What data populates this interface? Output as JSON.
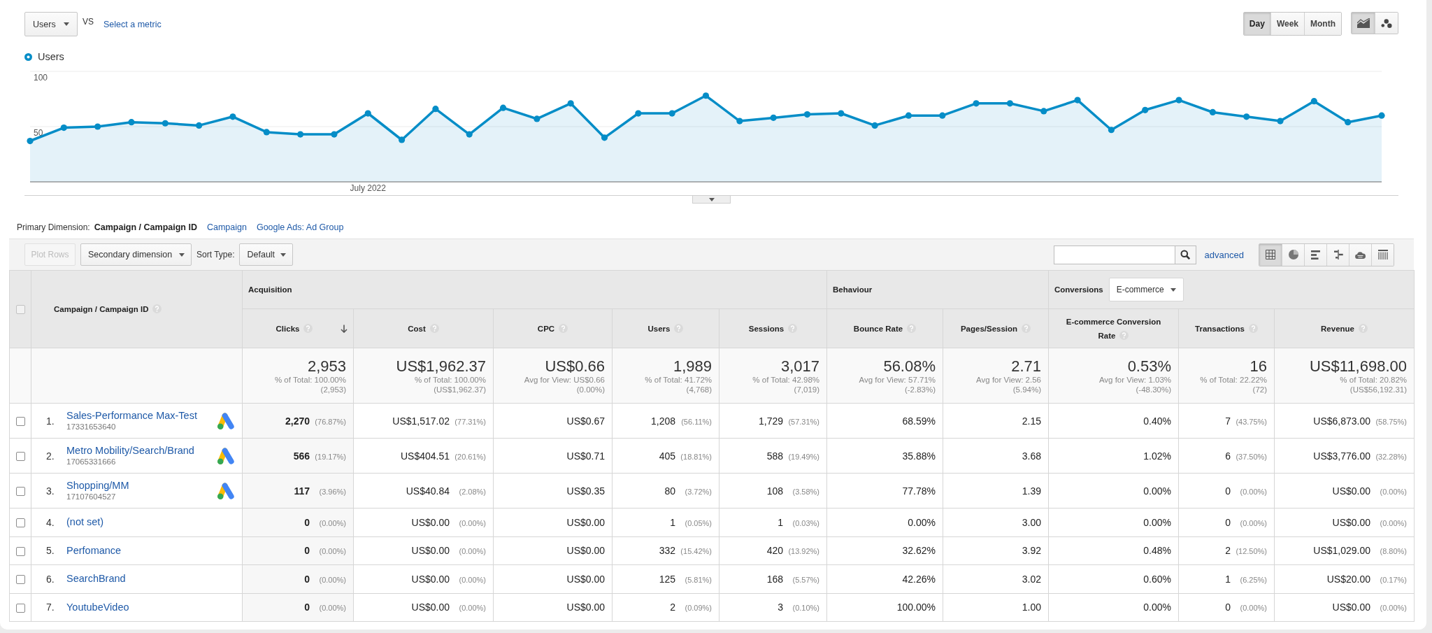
{
  "metric_selector": {
    "metric": "Users",
    "vs_label": "VS",
    "compare_link": "Select a metric"
  },
  "period_buttons": [
    {
      "label": "Day",
      "selected": true
    },
    {
      "label": "Week",
      "selected": false
    },
    {
      "label": "Month",
      "selected": false
    }
  ],
  "chart_type_buttons": [
    {
      "kind": "line",
      "selected": true
    },
    {
      "kind": "motion",
      "selected": false
    }
  ],
  "chart": {
    "chart_data": {
      "type": "area",
      "xlabel": "July 2022",
      "ylim": [
        0,
        100
      ],
      "yticks": [
        100,
        50
      ],
      "series": [
        {
          "name": "Users",
          "color": "#058dc7",
          "values": [
            37,
            49,
            50,
            54,
            53,
            51,
            59,
            45,
            43,
            43,
            62,
            38,
            66,
            43,
            67,
            57,
            71,
            40,
            62,
            62,
            78,
            55,
            58,
            61,
            62,
            51,
            60,
            60,
            71,
            71,
            64,
            74,
            47,
            65,
            74,
            63,
            59,
            55,
            73,
            54,
            60
          ]
        }
      ]
    }
  },
  "primary_dimension": {
    "label": "Primary Dimension:",
    "options": [
      {
        "label": "Campaign / Campaign ID",
        "selected": true
      },
      {
        "label": "Campaign",
        "selected": false
      },
      {
        "label": "Google Ads: Ad Group",
        "selected": false
      }
    ]
  },
  "toolbar": {
    "plot_rows": {
      "label": "Plot Rows",
      "disabled": true
    },
    "secondary_dimension": "Secondary dimension",
    "sort_type_label": "Sort Type:",
    "sort_type": "Default",
    "advanced_link": "advanced",
    "views": [
      {
        "kind": "table",
        "selected": true
      },
      {
        "kind": "pie",
        "selected": false
      },
      {
        "kind": "bar",
        "selected": false
      },
      {
        "kind": "comparison",
        "selected": false
      },
      {
        "kind": "cloud",
        "selected": false
      },
      {
        "kind": "pivot",
        "selected": false
      }
    ]
  },
  "table": {
    "select_all": {
      "checked": false
    },
    "dimension_column": {
      "label": "Campaign / Campaign ID",
      "sorted": false
    },
    "column_groups": [
      {
        "label": "Acquisition",
        "columns": [
          {
            "label": "Clicks",
            "sorted": true
          },
          {
            "label": "Cost",
            "sorted": false
          },
          {
            "label": "CPC",
            "sorted": false
          },
          {
            "label": "Users",
            "sorted": false
          },
          {
            "label": "Sessions",
            "sorted": false
          }
        ]
      },
      {
        "label": "Behaviour",
        "columns": [
          {
            "label": "Bounce Rate",
            "sorted": false
          },
          {
            "label": "Pages/Session",
            "sorted": false
          }
        ]
      },
      {
        "label": "Conversions",
        "dropdown": "E-commerce",
        "columns": [
          {
            "label": "E-commerce Conversion Rate",
            "sorted": false
          },
          {
            "label": "Transactions",
            "sorted": false
          },
          {
            "label": "Revenue",
            "sorted": false
          }
        ]
      }
    ],
    "totals": [
      {
        "value": "2,953",
        "caption": "% of Total: 100.00%",
        "detail": "(2,953)"
      },
      {
        "value": "US$1,962.37",
        "caption": "% of Total: 100.00%",
        "detail": "(US$1,962.37)"
      },
      {
        "value": "US$0.66",
        "caption": "Avg for View: US$0.66",
        "detail": "(0.00%)"
      },
      {
        "value": "1,989",
        "caption": "% of Total: 41.72%",
        "detail": "(4,768)"
      },
      {
        "value": "3,017",
        "caption": "% of Total: 42.98%",
        "detail": "(7,019)"
      },
      {
        "value": "56.08%",
        "caption": "Avg for View: 57.71%",
        "detail": "(-2.83%)"
      },
      {
        "value": "2.71",
        "caption": "Avg for View: 2.56",
        "detail": "(5.94%)"
      },
      {
        "value": "0.53%",
        "caption": "Avg for View: 1.03%",
        "detail": "(-48.30%)"
      },
      {
        "value": "16",
        "caption": "% of Total: 22.22%",
        "detail": "(72)"
      },
      {
        "value": "US$11,698.00",
        "caption": "% of Total: 20.82%",
        "detail": "(US$56,192.31)"
      }
    ],
    "rows": [
      {
        "index": "1.",
        "name": "Sales-Performance Max-Test",
        "campaign_id": "17331653640",
        "ads_linked": true,
        "checked": false,
        "cells": [
          {
            "value": "2,270",
            "share": "(76.87%)"
          },
          {
            "value": "US$1,517.02",
            "share": "(77.31%)"
          },
          {
            "value": "US$0.67"
          },
          {
            "value": "1,208",
            "share": "(56.11%)"
          },
          {
            "value": "1,729",
            "share": "(57.31%)"
          },
          {
            "value": "68.59%"
          },
          {
            "value": "2.15"
          },
          {
            "value": "0.40%"
          },
          {
            "value": "7",
            "share": "(43.75%)"
          },
          {
            "value": "US$6,873.00",
            "share": "(58.75%)"
          }
        ]
      },
      {
        "index": "2.",
        "name": "Metro Mobility/Search/Brand",
        "campaign_id": "17065331666",
        "ads_linked": true,
        "checked": false,
        "cells": [
          {
            "value": "566",
            "share": "(19.17%)"
          },
          {
            "value": "US$404.51",
            "share": "(20.61%)"
          },
          {
            "value": "US$0.71"
          },
          {
            "value": "405",
            "share": "(18.81%)"
          },
          {
            "value": "588",
            "share": "(19.49%)"
          },
          {
            "value": "35.88%"
          },
          {
            "value": "3.68"
          },
          {
            "value": "1.02%"
          },
          {
            "value": "6",
            "share": "(37.50%)"
          },
          {
            "value": "US$3,776.00",
            "share": "(32.28%)"
          }
        ]
      },
      {
        "index": "3.",
        "name": "Shopping/MM",
        "campaign_id": "17107604527",
        "ads_linked": true,
        "checked": false,
        "cells": [
          {
            "value": "117",
            "share": "(3.96%)"
          },
          {
            "value": "US$40.84",
            "share": "(2.08%)"
          },
          {
            "value": "US$0.35"
          },
          {
            "value": "80",
            "share": "(3.72%)"
          },
          {
            "value": "108",
            "share": "(3.58%)"
          },
          {
            "value": "77.78%"
          },
          {
            "value": "1.39"
          },
          {
            "value": "0.00%"
          },
          {
            "value": "0",
            "share": "(0.00%)"
          },
          {
            "value": "US$0.00",
            "share": "(0.00%)"
          }
        ]
      },
      {
        "index": "4.",
        "name": "(not set)",
        "ads_linked": false,
        "checked": false,
        "cells": [
          {
            "value": "0",
            "share": "(0.00%)"
          },
          {
            "value": "US$0.00",
            "share": "(0.00%)"
          },
          {
            "value": "US$0.00"
          },
          {
            "value": "1",
            "share": "(0.05%)"
          },
          {
            "value": "1",
            "share": "(0.03%)"
          },
          {
            "value": "0.00%"
          },
          {
            "value": "3.00"
          },
          {
            "value": "0.00%"
          },
          {
            "value": "0",
            "share": "(0.00%)"
          },
          {
            "value": "US$0.00",
            "share": "(0.00%)"
          }
        ]
      },
      {
        "index": "5.",
        "name": "Perfomance",
        "ads_linked": false,
        "checked": false,
        "cells": [
          {
            "value": "0",
            "share": "(0.00%)"
          },
          {
            "value": "US$0.00",
            "share": "(0.00%)"
          },
          {
            "value": "US$0.00"
          },
          {
            "value": "332",
            "share": "(15.42%)"
          },
          {
            "value": "420",
            "share": "(13.92%)"
          },
          {
            "value": "32.62%"
          },
          {
            "value": "3.92"
          },
          {
            "value": "0.48%"
          },
          {
            "value": "2",
            "share": "(12.50%)"
          },
          {
            "value": "US$1,029.00",
            "share": "(8.80%)"
          }
        ]
      },
      {
        "index": "6.",
        "name": "SearchBrand",
        "ads_linked": false,
        "checked": false,
        "cells": [
          {
            "value": "0",
            "share": "(0.00%)"
          },
          {
            "value": "US$0.00",
            "share": "(0.00%)"
          },
          {
            "value": "US$0.00"
          },
          {
            "value": "125",
            "share": "(5.81%)"
          },
          {
            "value": "168",
            "share": "(5.57%)"
          },
          {
            "value": "42.26%"
          },
          {
            "value": "3.02"
          },
          {
            "value": "0.60%"
          },
          {
            "value": "1",
            "share": "(6.25%)"
          },
          {
            "value": "US$20.00",
            "share": "(0.17%)"
          }
        ]
      },
      {
        "index": "7.",
        "name": "YoutubeVideo",
        "ads_linked": false,
        "checked": false,
        "cells": [
          {
            "value": "0",
            "share": "(0.00%)"
          },
          {
            "value": "US$0.00",
            "share": "(0.00%)"
          },
          {
            "value": "US$0.00"
          },
          {
            "value": "2",
            "share": "(0.09%)"
          },
          {
            "value": "3",
            "share": "(0.10%)"
          },
          {
            "value": "100.00%"
          },
          {
            "value": "1.00"
          },
          {
            "value": "0.00%"
          },
          {
            "value": "0",
            "share": "(0.00%)"
          },
          {
            "value": "US$0.00",
            "share": "(0.00%)"
          }
        ]
      }
    ]
  }
}
